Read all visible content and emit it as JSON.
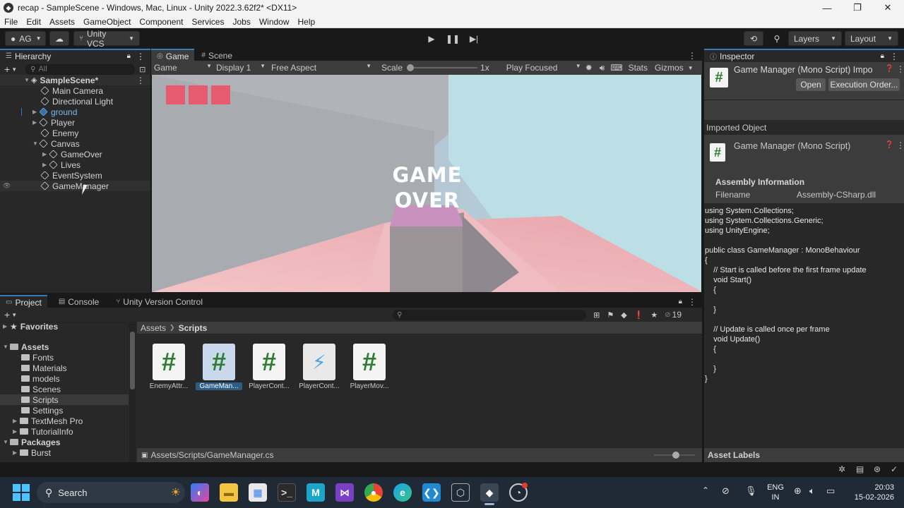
{
  "window": {
    "title": "recap - SampleScene - Windows, Mac, Linux - Unity 2022.3.62f2* <DX11>",
    "controls": [
      "—",
      "❐",
      "✕"
    ]
  },
  "menu": [
    "File",
    "Edit",
    "Assets",
    "GameObject",
    "Component",
    "Services",
    "Jobs",
    "Window",
    "Help"
  ],
  "toolbar": {
    "account": "AG",
    "vcs": "Unity VCS",
    "layers": "Layers",
    "layout": "Layout"
  },
  "hierarchy": {
    "tab": "Hierarchy",
    "search_placeholder": "All",
    "scene": "SampleScene*",
    "items": [
      {
        "label": "Main Camera"
      },
      {
        "label": "Directional Light"
      },
      {
        "label": "ground"
      },
      {
        "label": "Player"
      },
      {
        "label": "Enemy"
      },
      {
        "label": "Canvas"
      },
      {
        "label": "GameOver"
      },
      {
        "label": "Lives"
      },
      {
        "label": "EventSystem"
      },
      {
        "label": "GameManager"
      }
    ]
  },
  "game": {
    "tabs": [
      "Game",
      "Scene"
    ],
    "view": "Game",
    "display": "Display 1",
    "aspect": "Free Aspect",
    "scale_label": "Scale",
    "scale_value": "1x",
    "play_focused": "Play Focused",
    "stats": "Stats",
    "gizmos": "Gizmos",
    "overlay_line1": "GAME",
    "overlay_line2": "OVER",
    "lives_count": 3
  },
  "inspector": {
    "tab": "Inspector",
    "header_title": "Game Manager (Mono Script) Impo",
    "open_button": "Open",
    "exec_button": "Execution Order...",
    "imported_object": "Imported Object",
    "object_title": "Game Manager (Mono Script)",
    "assembly_header": "Assembly Information",
    "filename_label": "Filename",
    "filename_value": "Assembly-CSharp.dll",
    "code": "using System.Collections;\nusing System.Collections.Generic;\nusing UnityEngine;\n\npublic class GameManager : MonoBehaviour\n{\n    // Start is called before the first frame update\n    void Start()\n    {\n\n    }\n\n    // Update is called once per frame\n    void Update()\n    {\n\n    }\n}",
    "asset_labels": "Asset Labels"
  },
  "project": {
    "tabs": [
      "Project",
      "Console",
      "Unity Version Control"
    ],
    "hidden_count": "19",
    "favorites": "Favorites",
    "assets": "Assets",
    "folders": [
      "Fonts",
      "Materials",
      "models",
      "Scenes",
      "Scripts",
      "Settings",
      "TextMesh Pro",
      "TutorialInfo"
    ],
    "packages": "Packages",
    "package_items": [
      "Burst"
    ],
    "breadcrumb_root": "Assets",
    "breadcrumb_current": "Scripts",
    "assets_grid": [
      {
        "label": "EnemyAttr..."
      },
      {
        "label": "GameMan..."
      },
      {
        "label": "PlayerCont..."
      },
      {
        "label": "PlayerCont..."
      },
      {
        "label": "PlayerMov..."
      }
    ],
    "path": "Assets/Scripts/GameManager.cs"
  },
  "taskbar": {
    "search": "Search",
    "lang1": "ENG",
    "lang2": "IN",
    "time": "20:03",
    "date": "15-02-2026"
  }
}
